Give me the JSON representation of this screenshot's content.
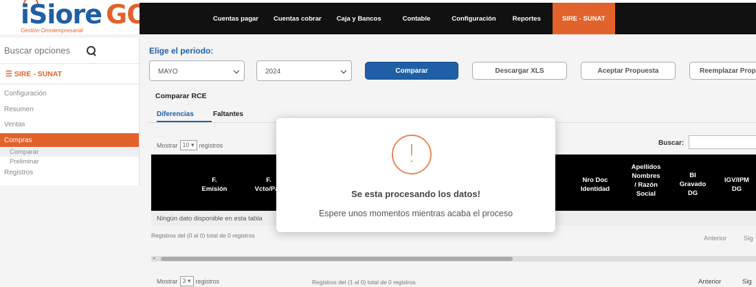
{
  "brand": {
    "name_main": "iSiore",
    "name_accent": "GO",
    "subtitle": "Gestión Omniempresarial"
  },
  "nav": {
    "items": [
      "Cuentas pagar",
      "Cuentas cobrar",
      "Caja y Bancos",
      "Contable",
      "Configuración",
      "Reportes"
    ],
    "active": "SIRE - SUNAT"
  },
  "sidebar": {
    "search_placeholder": "Buscar opciones",
    "module_title": "SIRE - SUNAT",
    "items": [
      "Configuración",
      "Resumen",
      "Ventas"
    ],
    "active_item": "Compras",
    "subitems": [
      "Comparar",
      "Preliminar"
    ],
    "last_item": "Registros"
  },
  "main": {
    "period_title": "Elige el periodo:",
    "month": "MAYO",
    "year": "2024",
    "buttons": {
      "compare": "Comparar",
      "download": "Descargar XLS",
      "accept": "Aceptar Propuesta",
      "replace": "Reemplazar Prop"
    },
    "section_title": "Comparar RCE",
    "tabs": [
      "Diferencias",
      "Faltantes"
    ],
    "show_label_pre": "Mostrar",
    "show_value": "10",
    "show_label_post": "registros",
    "search_label": "Buscar:",
    "columns": {
      "c1": [
        "F.",
        "Emisión"
      ],
      "c2": [
        "F.",
        "Vcto/Pag"
      ],
      "c3": [
        "Nro Doc",
        "Identidad"
      ],
      "c4": [
        "Apellidos",
        "Nombres",
        "/ Razón",
        "Social"
      ],
      "c5": [
        "BI",
        "Gravado",
        "DG"
      ],
      "c6": [
        "IGV/IPM",
        "DG"
      ]
    },
    "empty_message": "Ningún dato disponible en esta tabla",
    "info_top": "Registros del (0 al 0) total de 0 registros",
    "prev": "Anterior",
    "next": "Sig",
    "show_value_bottom": "3",
    "info_bottom": "Registros del (1 al 0) total de 0 registros"
  },
  "modal": {
    "icon": "!",
    "title": "Se esta procesando los datos!",
    "message": "Espere unos momentos mientras acaba el proceso"
  }
}
